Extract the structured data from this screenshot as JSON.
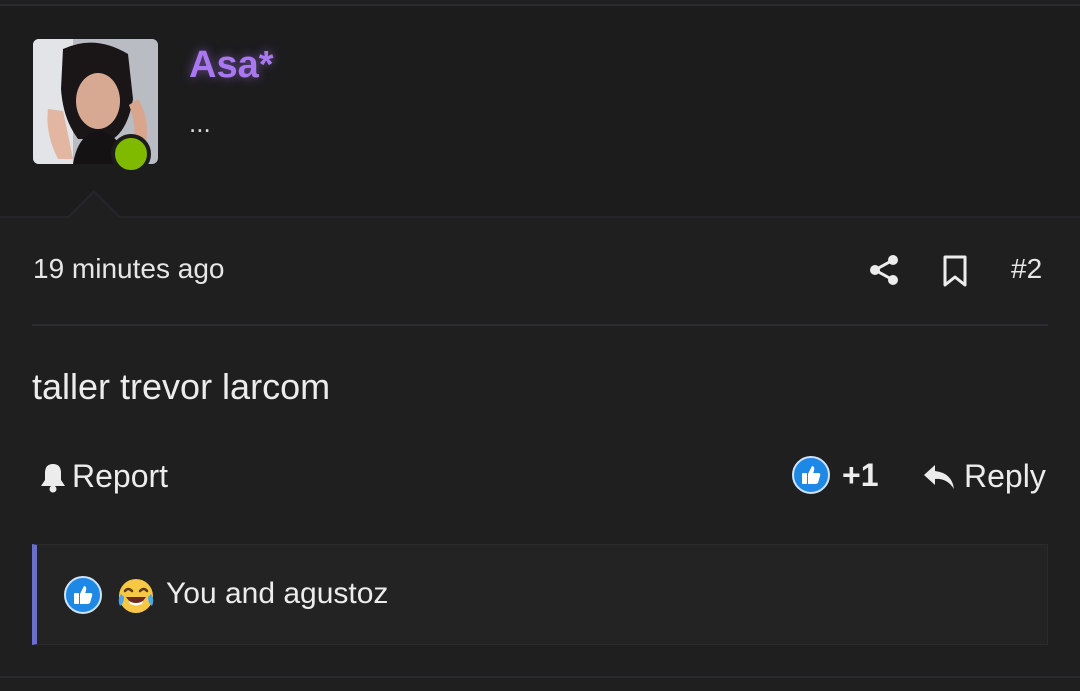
{
  "user": {
    "name": "Asa*",
    "title": "...",
    "name_color": "#a978f0",
    "online_color": "#7fba00"
  },
  "post": {
    "timestamp": "19 minutes ago",
    "number": "#2",
    "content": "taller trevor larcom"
  },
  "actions": {
    "report_label": "Report",
    "reaction_count": "+1",
    "reply_label": "Reply",
    "icons": [
      "bell-icon",
      "like-icon",
      "reply-arrow-icon",
      "share-icon",
      "bookmark-icon"
    ]
  },
  "reactions_summary": {
    "text": "You and agustoz",
    "icons": [
      "like-icon",
      "laughing-crying-emoji"
    ]
  },
  "colors": {
    "background": "#1f1f20",
    "like_blue": "#1e88e5",
    "accent_bar": "#6a70c8"
  }
}
